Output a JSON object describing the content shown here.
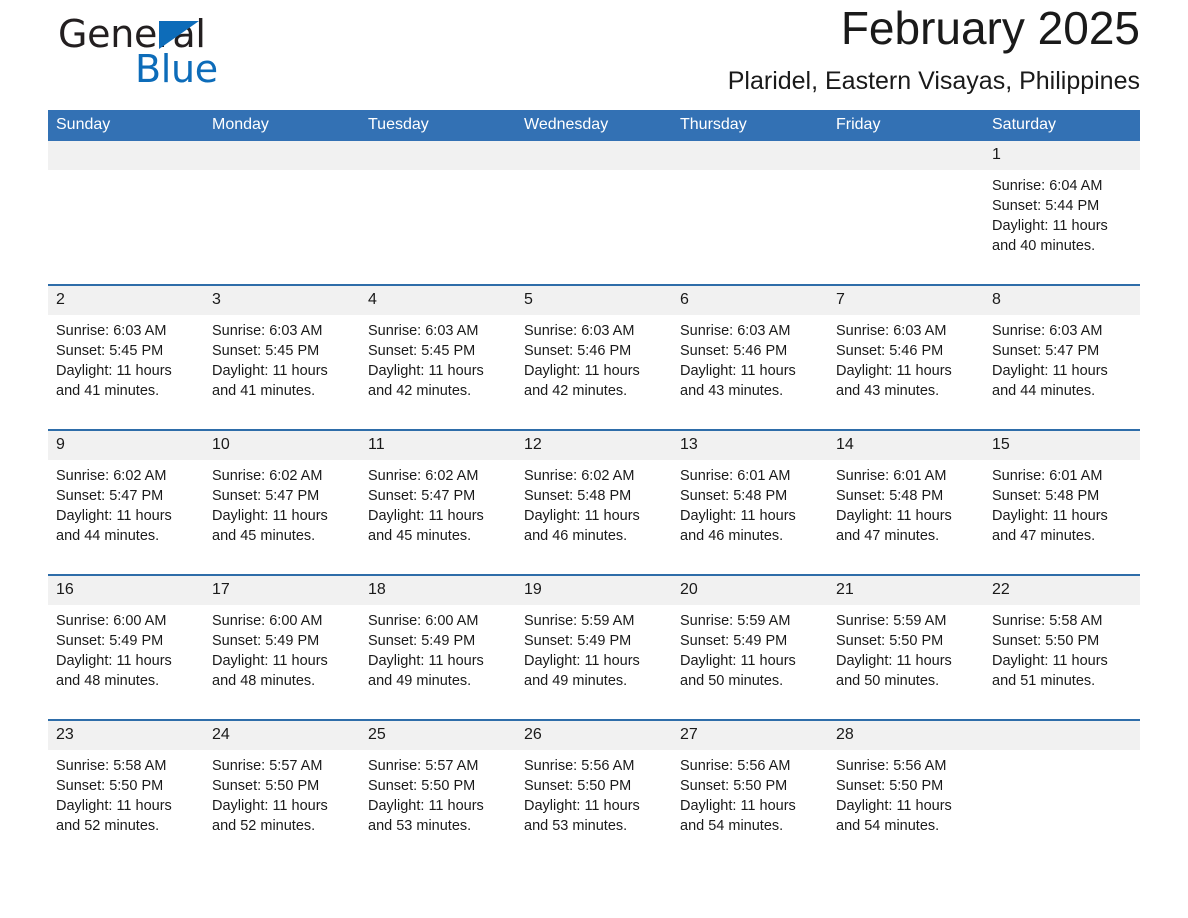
{
  "brand": {
    "name_part1": "General",
    "name_part2": "Blue",
    "accent_color": "#0d6cb9"
  },
  "header": {
    "month_title": "February 2025",
    "location": "Plaridel, Eastern Visayas, Philippines"
  },
  "theme": {
    "header_bg": "#3371b4",
    "row_separator": "#2e6da9",
    "daynum_bg": "#f1f1f1"
  },
  "calendar": {
    "weekday_headers": [
      "Sunday",
      "Monday",
      "Tuesday",
      "Wednesday",
      "Thursday",
      "Friday",
      "Saturday"
    ],
    "weeks": [
      [
        {
          "day": "",
          "sunrise": "",
          "sunset": "",
          "daylight_line1": "",
          "daylight_line2": ""
        },
        {
          "day": "",
          "sunrise": "",
          "sunset": "",
          "daylight_line1": "",
          "daylight_line2": ""
        },
        {
          "day": "",
          "sunrise": "",
          "sunset": "",
          "daylight_line1": "",
          "daylight_line2": ""
        },
        {
          "day": "",
          "sunrise": "",
          "sunset": "",
          "daylight_line1": "",
          "daylight_line2": ""
        },
        {
          "day": "",
          "sunrise": "",
          "sunset": "",
          "daylight_line1": "",
          "daylight_line2": ""
        },
        {
          "day": "",
          "sunrise": "",
          "sunset": "",
          "daylight_line1": "",
          "daylight_line2": ""
        },
        {
          "day": "1",
          "sunrise": "Sunrise: 6:04 AM",
          "sunset": "Sunset: 5:44 PM",
          "daylight_line1": "Daylight: 11 hours",
          "daylight_line2": "and 40 minutes."
        }
      ],
      [
        {
          "day": "2",
          "sunrise": "Sunrise: 6:03 AM",
          "sunset": "Sunset: 5:45 PM",
          "daylight_line1": "Daylight: 11 hours",
          "daylight_line2": "and 41 minutes."
        },
        {
          "day": "3",
          "sunrise": "Sunrise: 6:03 AM",
          "sunset": "Sunset: 5:45 PM",
          "daylight_line1": "Daylight: 11 hours",
          "daylight_line2": "and 41 minutes."
        },
        {
          "day": "4",
          "sunrise": "Sunrise: 6:03 AM",
          "sunset": "Sunset: 5:45 PM",
          "daylight_line1": "Daylight: 11 hours",
          "daylight_line2": "and 42 minutes."
        },
        {
          "day": "5",
          "sunrise": "Sunrise: 6:03 AM",
          "sunset": "Sunset: 5:46 PM",
          "daylight_line1": "Daylight: 11 hours",
          "daylight_line2": "and 42 minutes."
        },
        {
          "day": "6",
          "sunrise": "Sunrise: 6:03 AM",
          "sunset": "Sunset: 5:46 PM",
          "daylight_line1": "Daylight: 11 hours",
          "daylight_line2": "and 43 minutes."
        },
        {
          "day": "7",
          "sunrise": "Sunrise: 6:03 AM",
          "sunset": "Sunset: 5:46 PM",
          "daylight_line1": "Daylight: 11 hours",
          "daylight_line2": "and 43 minutes."
        },
        {
          "day": "8",
          "sunrise": "Sunrise: 6:03 AM",
          "sunset": "Sunset: 5:47 PM",
          "daylight_line1": "Daylight: 11 hours",
          "daylight_line2": "and 44 minutes."
        }
      ],
      [
        {
          "day": "9",
          "sunrise": "Sunrise: 6:02 AM",
          "sunset": "Sunset: 5:47 PM",
          "daylight_line1": "Daylight: 11 hours",
          "daylight_line2": "and 44 minutes."
        },
        {
          "day": "10",
          "sunrise": "Sunrise: 6:02 AM",
          "sunset": "Sunset: 5:47 PM",
          "daylight_line1": "Daylight: 11 hours",
          "daylight_line2": "and 45 minutes."
        },
        {
          "day": "11",
          "sunrise": "Sunrise: 6:02 AM",
          "sunset": "Sunset: 5:47 PM",
          "daylight_line1": "Daylight: 11 hours",
          "daylight_line2": "and 45 minutes."
        },
        {
          "day": "12",
          "sunrise": "Sunrise: 6:02 AM",
          "sunset": "Sunset: 5:48 PM",
          "daylight_line1": "Daylight: 11 hours",
          "daylight_line2": "and 46 minutes."
        },
        {
          "day": "13",
          "sunrise": "Sunrise: 6:01 AM",
          "sunset": "Sunset: 5:48 PM",
          "daylight_line1": "Daylight: 11 hours",
          "daylight_line2": "and 46 minutes."
        },
        {
          "day": "14",
          "sunrise": "Sunrise: 6:01 AM",
          "sunset": "Sunset: 5:48 PM",
          "daylight_line1": "Daylight: 11 hours",
          "daylight_line2": "and 47 minutes."
        },
        {
          "day": "15",
          "sunrise": "Sunrise: 6:01 AM",
          "sunset": "Sunset: 5:48 PM",
          "daylight_line1": "Daylight: 11 hours",
          "daylight_line2": "and 47 minutes."
        }
      ],
      [
        {
          "day": "16",
          "sunrise": "Sunrise: 6:00 AM",
          "sunset": "Sunset: 5:49 PM",
          "daylight_line1": "Daylight: 11 hours",
          "daylight_line2": "and 48 minutes."
        },
        {
          "day": "17",
          "sunrise": "Sunrise: 6:00 AM",
          "sunset": "Sunset: 5:49 PM",
          "daylight_line1": "Daylight: 11 hours",
          "daylight_line2": "and 48 minutes."
        },
        {
          "day": "18",
          "sunrise": "Sunrise: 6:00 AM",
          "sunset": "Sunset: 5:49 PM",
          "daylight_line1": "Daylight: 11 hours",
          "daylight_line2": "and 49 minutes."
        },
        {
          "day": "19",
          "sunrise": "Sunrise: 5:59 AM",
          "sunset": "Sunset: 5:49 PM",
          "daylight_line1": "Daylight: 11 hours",
          "daylight_line2": "and 49 minutes."
        },
        {
          "day": "20",
          "sunrise": "Sunrise: 5:59 AM",
          "sunset": "Sunset: 5:49 PM",
          "daylight_line1": "Daylight: 11 hours",
          "daylight_line2": "and 50 minutes."
        },
        {
          "day": "21",
          "sunrise": "Sunrise: 5:59 AM",
          "sunset": "Sunset: 5:50 PM",
          "daylight_line1": "Daylight: 11 hours",
          "daylight_line2": "and 50 minutes."
        },
        {
          "day": "22",
          "sunrise": "Sunrise: 5:58 AM",
          "sunset": "Sunset: 5:50 PM",
          "daylight_line1": "Daylight: 11 hours",
          "daylight_line2": "and 51 minutes."
        }
      ],
      [
        {
          "day": "23",
          "sunrise": "Sunrise: 5:58 AM",
          "sunset": "Sunset: 5:50 PM",
          "daylight_line1": "Daylight: 11 hours",
          "daylight_line2": "and 52 minutes."
        },
        {
          "day": "24",
          "sunrise": "Sunrise: 5:57 AM",
          "sunset": "Sunset: 5:50 PM",
          "daylight_line1": "Daylight: 11 hours",
          "daylight_line2": "and 52 minutes."
        },
        {
          "day": "25",
          "sunrise": "Sunrise: 5:57 AM",
          "sunset": "Sunset: 5:50 PM",
          "daylight_line1": "Daylight: 11 hours",
          "daylight_line2": "and 53 minutes."
        },
        {
          "day": "26",
          "sunrise": "Sunrise: 5:56 AM",
          "sunset": "Sunset: 5:50 PM",
          "daylight_line1": "Daylight: 11 hours",
          "daylight_line2": "and 53 minutes."
        },
        {
          "day": "27",
          "sunrise": "Sunrise: 5:56 AM",
          "sunset": "Sunset: 5:50 PM",
          "daylight_line1": "Daylight: 11 hours",
          "daylight_line2": "and 54 minutes."
        },
        {
          "day": "28",
          "sunrise": "Sunrise: 5:56 AM",
          "sunset": "Sunset: 5:50 PM",
          "daylight_line1": "Daylight: 11 hours",
          "daylight_line2": "and 54 minutes."
        },
        {
          "day": "",
          "sunrise": "",
          "sunset": "",
          "daylight_line1": "",
          "daylight_line2": ""
        }
      ]
    ]
  }
}
